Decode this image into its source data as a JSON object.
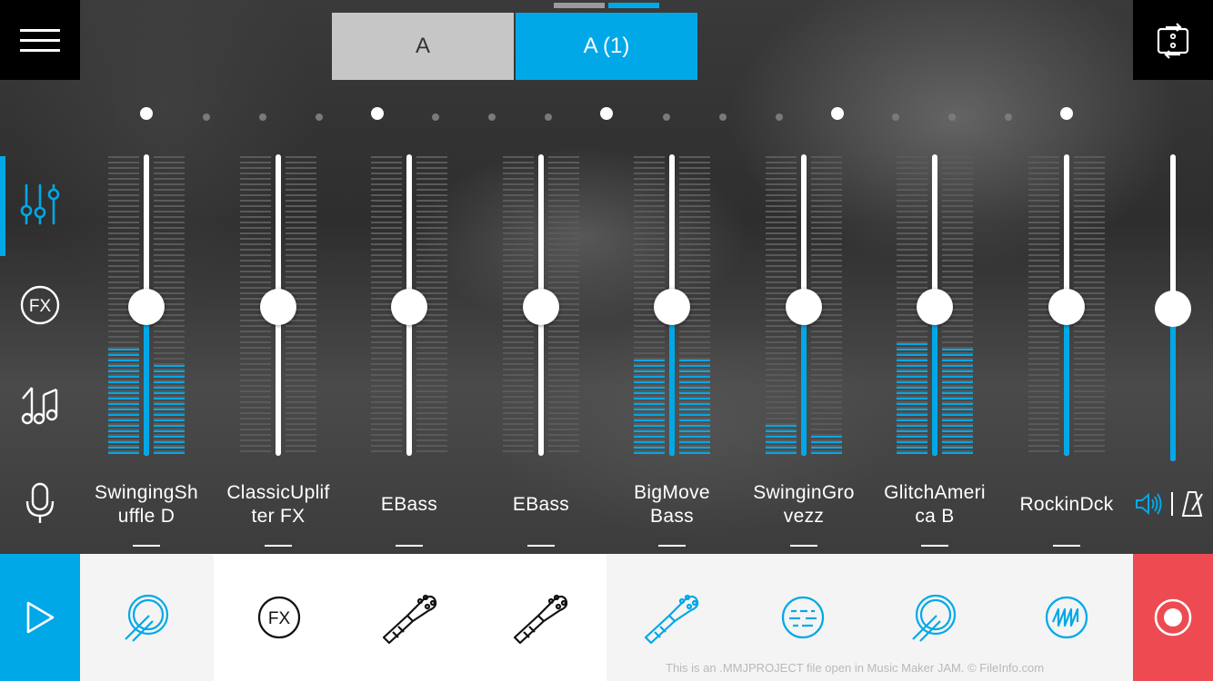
{
  "header": {
    "scene_tabs": [
      {
        "label": "A",
        "active": false
      },
      {
        "label": "A (1)",
        "active": true
      }
    ]
  },
  "colors": {
    "accent": "#00a8e8",
    "record": "#ee4a52"
  },
  "sidebar": {
    "items": [
      {
        "icon": "mixer-sliders-icon",
        "active": true
      },
      {
        "icon": "fx-icon",
        "active": false
      },
      {
        "icon": "music-notes-icon",
        "active": false
      },
      {
        "icon": "microphone-icon",
        "active": false
      }
    ]
  },
  "channels": [
    {
      "name": "SwingingShuffle D",
      "label_lines": [
        "SwingingSh",
        "uffle D"
      ],
      "fader_level": 0.5,
      "meter_left": 0.36,
      "meter_right": 0.3,
      "active": true,
      "instrument_icon": "drum-icon",
      "instrument_active": true
    },
    {
      "name": "ClassicUplifter FX",
      "label_lines": [
        "ClassicUplif",
        "ter FX"
      ],
      "fader_level": 0.5,
      "meter_left": 0,
      "meter_right": 0,
      "active": false,
      "instrument_icon": "fx-icon",
      "instrument_active": false
    },
    {
      "name": "EBass",
      "label_lines": [
        "EBass"
      ],
      "fader_level": 0.5,
      "meter_left": 0,
      "meter_right": 0,
      "active": false,
      "instrument_icon": "bass-guitar-icon",
      "instrument_active": false
    },
    {
      "name": "EBass",
      "label_lines": [
        "EBass"
      ],
      "fader_level": 0.5,
      "meter_left": 0,
      "meter_right": 0,
      "active": false,
      "instrument_icon": "bass-guitar-icon",
      "instrument_active": false
    },
    {
      "name": "BigMove Bass",
      "label_lines": [
        "BigMove",
        "Bass"
      ],
      "fader_level": 0.5,
      "meter_left": 0.33,
      "meter_right": 0.33,
      "active": true,
      "instrument_icon": "bass-guitar-icon",
      "instrument_active": true
    },
    {
      "name": "SwinginGrovezz",
      "label_lines": [
        "SwinginGro",
        "vezz"
      ],
      "fader_level": 0.5,
      "meter_left": 0.1,
      "meter_right": 0.07,
      "active": true,
      "instrument_icon": "synth-pad-icon",
      "instrument_active": true
    },
    {
      "name": "GlitchAmerica B",
      "label_lines": [
        "GlitchAmeri",
        "ca B"
      ],
      "fader_level": 0.5,
      "meter_left": 0.38,
      "meter_right": 0.36,
      "active": true,
      "instrument_icon": "drum-icon",
      "instrument_active": true
    },
    {
      "name": "RockinDck",
      "label_lines": [
        "RockinDck"
      ],
      "fader_level": 0.5,
      "meter_left": 0,
      "meter_right": 0,
      "active": true,
      "instrument_icon": "waveform-icon",
      "instrument_active": true
    }
  ],
  "master": {
    "level": 0.45
  },
  "transport": {
    "play_icon": "play-icon",
    "record_icon": "record-icon"
  },
  "footer": {
    "credit": "This is an .MMJPROJECT file open in Music Maker JAM. © FileInfo.com"
  }
}
